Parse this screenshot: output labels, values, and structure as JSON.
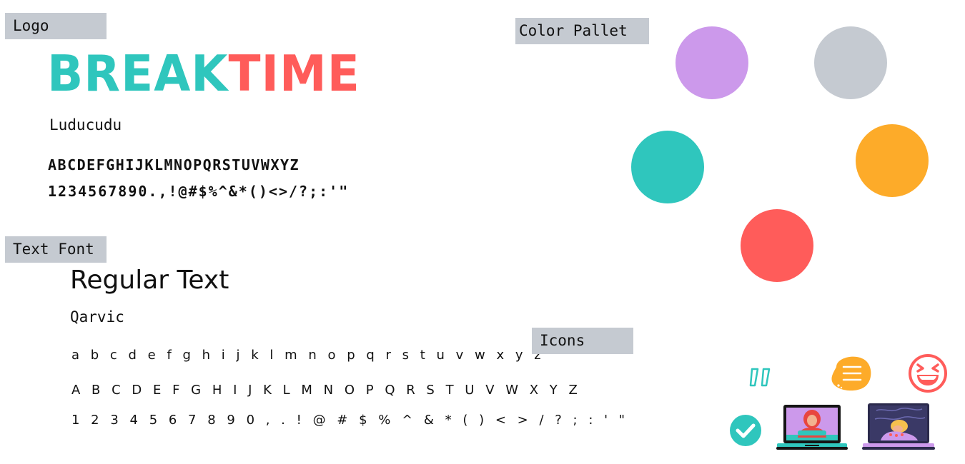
{
  "sections": {
    "logo_label": "Logo",
    "color_label": "Color Pallet",
    "text_font_label": "Text Font",
    "icons_label": "Icons"
  },
  "logo": {
    "word1": "BREAK",
    "word2": "TIME",
    "font_name": "Luducudu",
    "alphabet": "ABCDEFGHIJKLMNOPQRSTUVWXYZ",
    "numbers_symbols": "1234567890.,!@#$%^&*()<>/?;:'\""
  },
  "text_font": {
    "title": "Regular Text",
    "font_name": "Qarvic",
    "lowercase": "a b c d e f g h i j k l m n o p q r s t u v w x y z",
    "uppercase": "A B C D E F G H I J K L M N O P Q R S T U V W X Y Z",
    "numbers_symbols": "1 2 3 4 5 6 7 8 9 0 , . ! @ # $ % ^ & * ( ) < > / ? ; : ' \""
  },
  "palette": [
    {
      "name": "lavender",
      "hex": "#cc99eb"
    },
    {
      "name": "light-gray",
      "hex": "#c5cad1"
    },
    {
      "name": "teal",
      "hex": "#2fc6bd"
    },
    {
      "name": "orange",
      "hex": "#fdab29"
    },
    {
      "name": "coral-red",
      "hex": "#ff5c5a"
    }
  ],
  "icons": [
    "quote-icon",
    "menu-blob-icon",
    "laughing-face-icon",
    "check-circle-icon",
    "laptop-woman-icon",
    "laptop-sleeping-icon"
  ]
}
